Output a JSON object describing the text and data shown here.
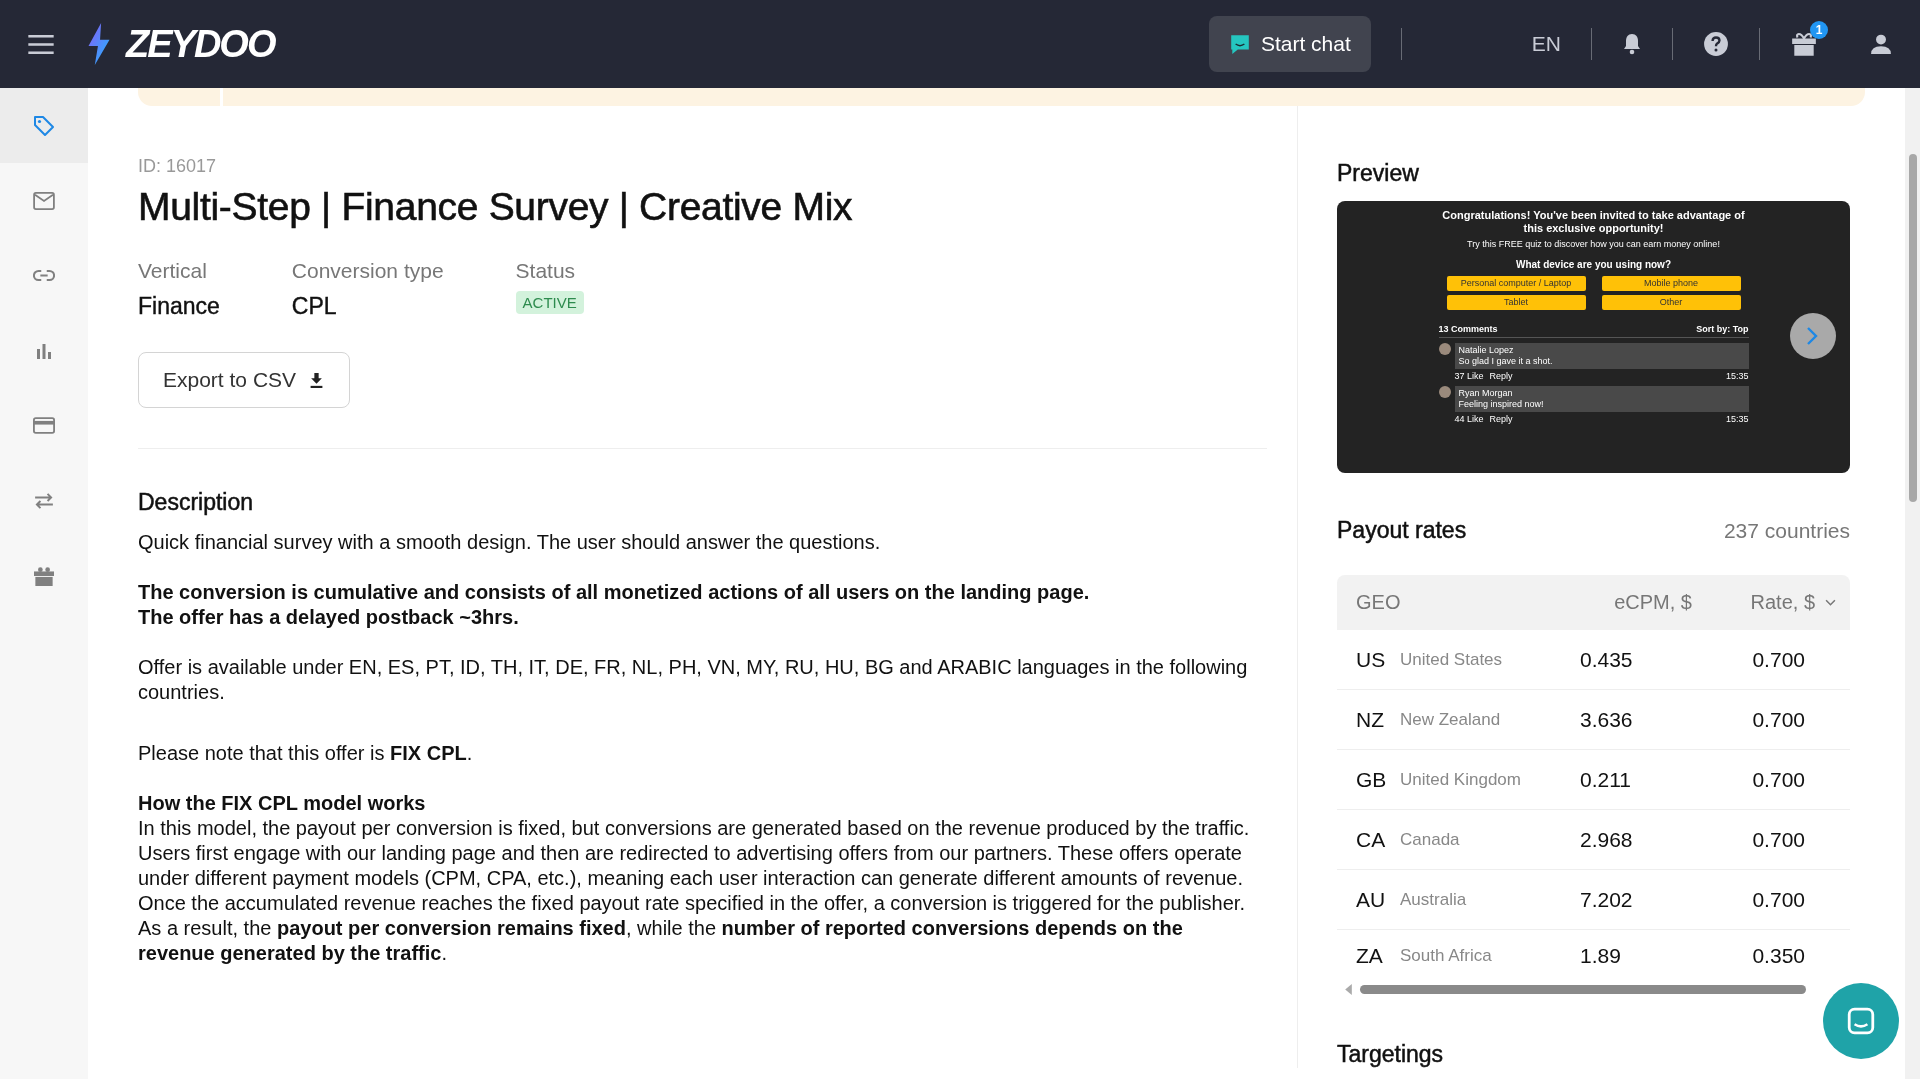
{
  "topbar": {
    "logo": "ZEYDOO",
    "chat_button": "Start chat",
    "language": "EN",
    "gift_badge": "1"
  },
  "sidebar": {
    "items": [
      {
        "kind": "tag",
        "selected": true
      },
      {
        "kind": "mail",
        "selected": false
      },
      {
        "kind": "link",
        "selected": false
      },
      {
        "kind": "chart",
        "selected": false
      },
      {
        "kind": "card",
        "selected": false
      },
      {
        "kind": "arrows",
        "selected": false
      },
      {
        "kind": "gift",
        "selected": false
      }
    ]
  },
  "offer": {
    "id": "ID: 16017",
    "title": "Multi-Step | Finance Survey | Creative Mix",
    "fields": [
      {
        "label": "Vertical",
        "value": "Finance",
        "kind": "text"
      },
      {
        "label": "Conversion type",
        "value": "CPL",
        "kind": "text"
      },
      {
        "label": "Status",
        "value": "ACTIVE",
        "kind": "badge"
      }
    ],
    "export_button": "Export to CSV"
  },
  "description": {
    "heading": "Description",
    "paragraphs": [
      {
        "lines": [
          {
            "text": "Quick financial survey with a smooth design. The user should answer the questions.",
            "bold": false
          }
        ]
      },
      {
        "lines": [
          {
            "text": "The conversion is cumulative and consists of all monetized actions of all users on the landing page.",
            "bold": true
          },
          {
            "text": "The offer has a delayed postback ~3hrs.",
            "bold": true
          }
        ]
      },
      {
        "lines": [
          {
            "text": "Offer is available under EN, ES, PT, ID, TH, IT, DE, FR, NL, PH, VN, MY, RU, HU, BG and ARABIC languages in the following countries.",
            "bold": false
          }
        ]
      },
      {
        "lines": [
          {
            "text": "Please note that this offer is **FIX CPL**.",
            "bold": false
          }
        ]
      },
      {
        "lines": [
          {
            "text": "How the FIX CPL model works",
            "bold": true
          },
          {
            "text": "In this model, the payout per conversion is fixed, but conversions are generated based on the revenue produced by the traffic.",
            "bold": false
          },
          {
            "text": "Users first engage with our landing page and then are redirected to advertising offers from our partners. These offers operate under different payment models (CPM, CPA, etc.), meaning each user interaction can generate different amounts of revenue.",
            "bold": false
          },
          {
            "text": "Once the accumulated revenue reaches the fixed payout rate specified in the offer, a conversion is triggered for the publisher.",
            "bold": false
          },
          {
            "text": "As a result, the **payout per conversion remains fixed**, while the **number of reported conversions depends on the revenue generated by the traffic**.",
            "bold": false
          }
        ]
      }
    ]
  },
  "preview": {
    "heading": "Preview",
    "screenshot": {
      "headline": "Congratulations! You've been invited to take advantage of this exclusive opportunity!",
      "subline": "Try this FREE quiz to discover how you can earn money online!",
      "question": "What device are you using now?",
      "options": [
        "Personal computer / Laptop",
        "Mobile phone",
        "Tablet",
        "Other"
      ],
      "comments_count": "13 Comments",
      "sort": "Sort by: Top",
      "comments": [
        {
          "name": "Natalie Lopez",
          "text": "So glad I gave it a shot.",
          "likes": "37 Like",
          "reply": "Reply",
          "time": "15:35"
        },
        {
          "name": "Ryan Morgan",
          "text": "Feeling inspired now!",
          "likes": "44 Like",
          "reply": "Reply",
          "time": "15:35"
        }
      ]
    }
  },
  "payout": {
    "heading": "Payout rates",
    "count": "237 countries",
    "columns": [
      "GEO",
      "eCPM, $",
      "Rate, $"
    ],
    "rows": [
      {
        "code": "US",
        "country": "United States",
        "ecpm": "0.435",
        "rate": "0.700"
      },
      {
        "code": "NZ",
        "country": "New Zealand",
        "ecpm": "3.636",
        "rate": "0.700"
      },
      {
        "code": "GB",
        "country": "United Kingdom",
        "ecpm": "0.211",
        "rate": "0.700"
      },
      {
        "code": "CA",
        "country": "Canada",
        "ecpm": "2.968",
        "rate": "0.700"
      },
      {
        "code": "AU",
        "country": "Australia",
        "ecpm": "7.202",
        "rate": "0.700"
      },
      {
        "code": "ZA",
        "country": "South Africa",
        "ecpm": "1.89",
        "rate": "0.350"
      }
    ]
  },
  "targetings": {
    "heading": "Targetings"
  }
}
